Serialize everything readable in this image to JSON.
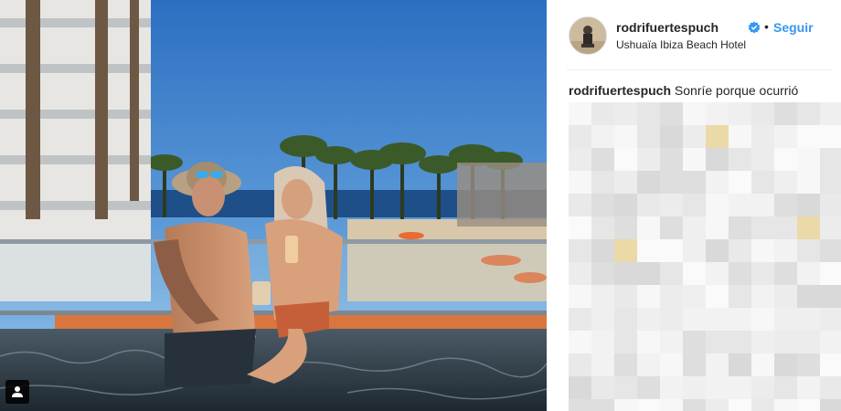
{
  "post": {
    "image_alt": "Couple in rooftop pool at beach hotel with palm trees and sea",
    "user_tag_icon": "person-icon"
  },
  "header": {
    "username": "rodrifuertespuch",
    "verified_icon": "verified-badge-icon",
    "separator": "•",
    "follow_label": "Seguir",
    "location": "Ushuaïa Ibiza Beach Hotel"
  },
  "caption": {
    "username": "rodrifuertespuch",
    "text": "Sonríe porque ocurrió"
  },
  "colors": {
    "link": "#3897f0",
    "text": "#262626",
    "divider": "#efefef"
  }
}
